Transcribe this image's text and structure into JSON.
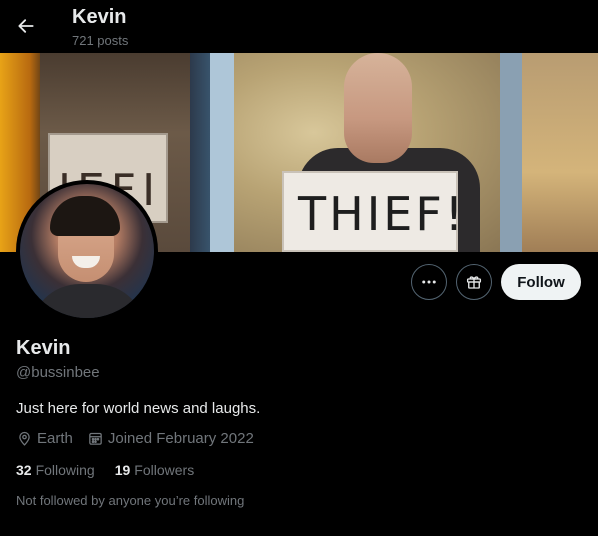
{
  "header": {
    "title": "Kevin",
    "post_count": "721 posts"
  },
  "profile": {
    "name": "Kevin",
    "handle": "@bussinbee",
    "bio": "Just here for world news and laughs.",
    "location": "Earth",
    "joined": "Joined February 2022",
    "following_count": "32",
    "following_label": "Following",
    "followers_count": "19",
    "followers_label": "Followers",
    "mutuals_note": "Not followed by anyone you’re following"
  },
  "banner": {
    "sign_text": "THIEF!",
    "sign_left_text": "IEFI"
  },
  "actions": {
    "follow_label": "Follow"
  },
  "icons": {
    "back": "arrow-left-icon",
    "more": "more-horizontal-icon",
    "gift": "gift-icon",
    "location": "location-pin-icon",
    "calendar": "calendar-icon"
  },
  "colors": {
    "background": "#000000",
    "text_primary": "#e7e9ea",
    "text_secondary": "#71767b",
    "follow_button_bg": "#eff3f4",
    "button_border": "#536471"
  }
}
